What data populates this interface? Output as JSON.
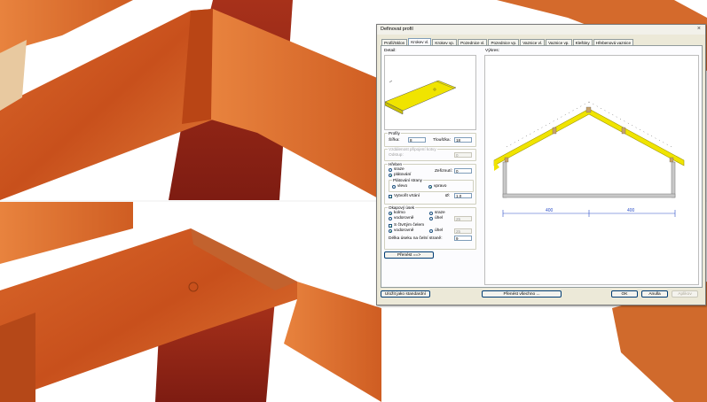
{
  "scene": {
    "top_photo": "roof-truss-rafter-joint",
    "bottom_photo": "roof-truss-rafter-joint-detail"
  },
  "dialog": {
    "title": "Definovat profil",
    "close_glyph": "×",
    "tabs": [
      {
        "label": "Profil/Sklon"
      },
      {
        "label": "Krokev vl."
      },
      {
        "label": "Krokev vp."
      },
      {
        "label": "Pozednice vl."
      },
      {
        "label": "Pozednice vp."
      },
      {
        "label": "Vaznice vl."
      },
      {
        "label": "Vaznice vp."
      },
      {
        "label": "Kleštiny"
      },
      {
        "label": "Hřebenová vaznice"
      }
    ],
    "active_tab": 1,
    "detail_label": "Detail:",
    "view_label": "Výkres:",
    "profile": {
      "group_title": "Profily",
      "width_label": "Šířka:",
      "width_value": "8",
      "thickness_label": "Tloušťka:",
      "thickness_value": "18"
    },
    "disabled_group": {
      "title": "Vzdálenost připojení kotvy",
      "label": "Odstup:",
      "value": "0"
    },
    "ridge": {
      "group_title": "Hřeben",
      "radio_abutting": "sraze",
      "radio_overlap": "plátování",
      "shortening_label": "Zeřiznutí:",
      "shortening_value": "0",
      "overlap_side_title": "Plátování strany",
      "left_label": "vlevo",
      "right_label": "vpravo",
      "hole_label": "Vytvořit vrtání",
      "diameter_label": "Ø:",
      "diameter_value": "1.0"
    },
    "eave": {
      "group_title": "Okapový úsek",
      "perpendicular_label": "kolmo",
      "abutting_label": "sraze",
      "horizontal_label": "vodorovně",
      "angle_label": "úhel",
      "angle_value": "25",
      "end_cut_label": "S čtvrtým čelem",
      "horizontal2_label": "vodorovně",
      "angle2_label": "úhel",
      "angle2_value": "25",
      "length_label": "Délka úseku na čelní straně:",
      "length_value": "9"
    },
    "transfer_button": "Přenést ==>",
    "drawing": {
      "dim_left": "400",
      "dim_right": "400",
      "rafter_color": "#f0e400"
    },
    "footer": {
      "save_default": "Uložit jako standardní",
      "transfer_all": "Přenést všechno ...",
      "ok": "OK",
      "cancel": "Anulla",
      "apply": "Aplikov"
    }
  }
}
